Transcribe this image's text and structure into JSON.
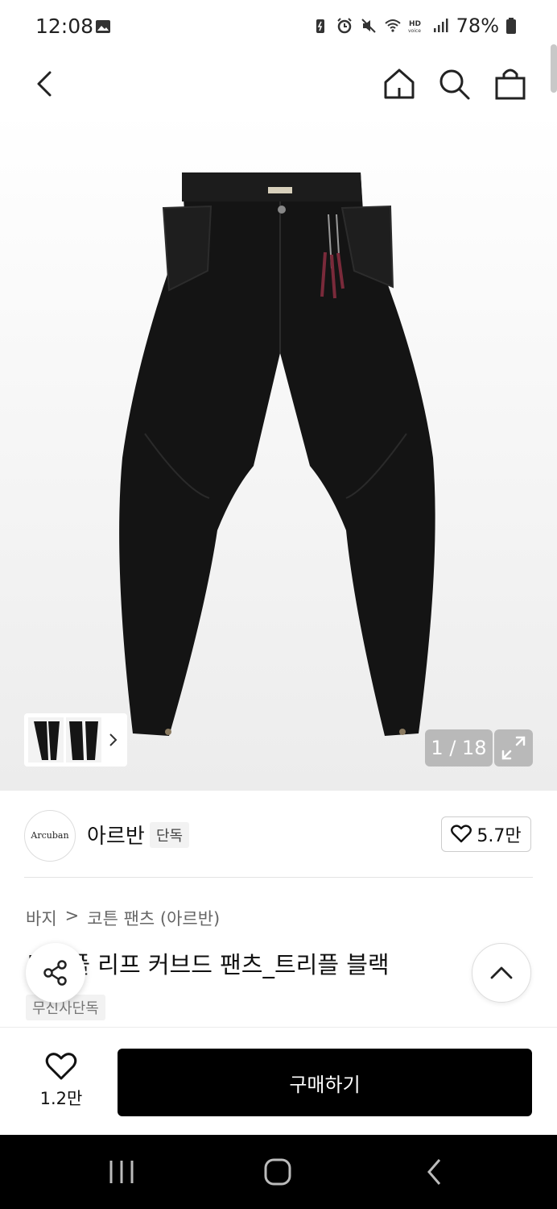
{
  "status_bar": {
    "time": "12:08",
    "battery": "78%",
    "icons": [
      "image-icon",
      "battery-saver-icon",
      "alarm-icon",
      "mute-icon",
      "wifi-icon",
      "hd-voice-icon",
      "signal-icon",
      "battery-icon"
    ]
  },
  "nav": {
    "back_icon": "back-arrow-icon",
    "home_icon": "home-icon",
    "search_icon": "search-icon",
    "bag_icon": "shopping-bag-icon"
  },
  "gallery": {
    "counter": "1 / 18",
    "thumb_icon": "chevron-right-icon",
    "expand_icon": "expand-icon"
  },
  "brand": {
    "logo_text": "Arcuban",
    "name": "아르반",
    "badge": "단독",
    "likes": "5.7만"
  },
  "breadcrumb": {
    "category": "바지",
    "separator": ">",
    "subcategory": "코튼 팬츠 (아르반)"
  },
  "product": {
    "title": "트리플 리프 커브드 팬츠_트리플 블랙",
    "tag": "무신사단독"
  },
  "bottom_bar": {
    "wish_count": "1.2만",
    "buy_label": "구매하기"
  },
  "colors": {
    "buy_button": "#000000",
    "image_bg": "#f0f0f0",
    "overlay_badge": "#b9b9b9"
  }
}
